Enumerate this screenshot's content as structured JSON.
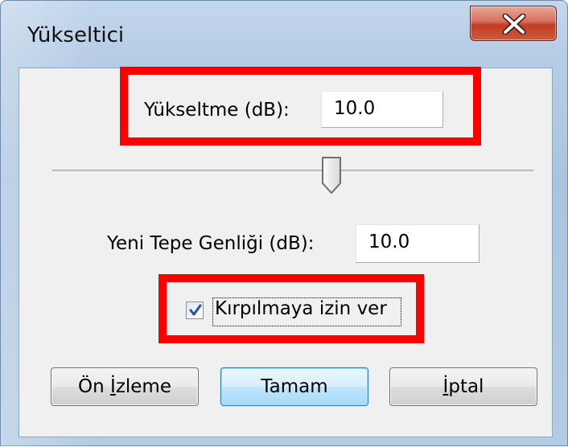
{
  "window": {
    "title": "Yükseltici"
  },
  "gain": {
    "label": "Yükseltme (dB):",
    "value": "10.0"
  },
  "slider": {
    "position_fraction": 0.58
  },
  "peak": {
    "label": "Yeni Tepe Genliği (dB):",
    "value": "10.0"
  },
  "clipping": {
    "label": "Kırpılmaya izin ver",
    "checked": true
  },
  "buttons": {
    "preview_prefix": "Ön ",
    "preview_underlined": "İ",
    "preview_suffix": "zleme",
    "ok": "Tamam",
    "cancel_underlined": "İ",
    "cancel_suffix": "ptal"
  },
  "icons": {
    "close": "close-x-icon",
    "check": "checkmark-icon",
    "thumb": "slider-thumb"
  },
  "colors": {
    "highlight": "#ff0000",
    "close_button": "#c23d22",
    "default_button_border": "#3c7fb1"
  }
}
